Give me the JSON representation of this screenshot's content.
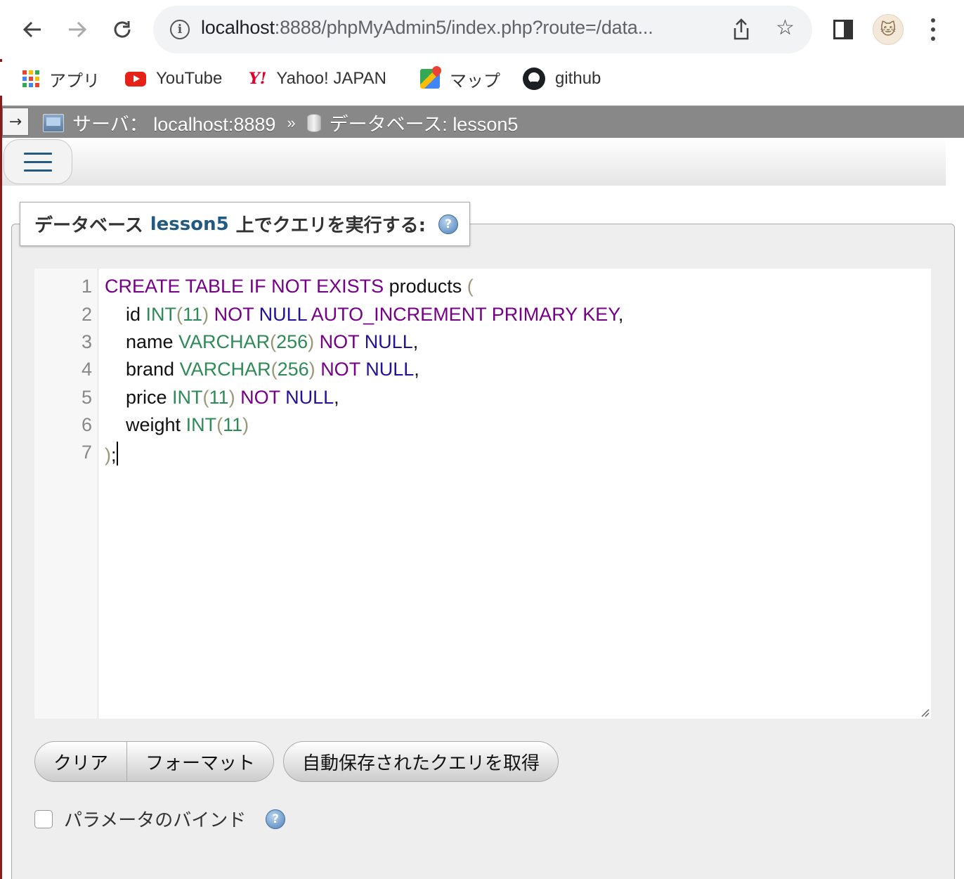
{
  "browser": {
    "url_host": "localhost",
    "url_rest": ":8888/phpMyAdmin5/index.php?route=/data...",
    "bookmarks": [
      {
        "label": "アプリ",
        "icon": "apps-grid-icon"
      },
      {
        "label": "YouTube",
        "icon": "youtube-icon"
      },
      {
        "label": "Yahoo! JAPAN",
        "icon": "yahoo-icon"
      },
      {
        "label": "マップ",
        "icon": "maps-icon"
      },
      {
        "label": "github",
        "icon": "github-icon"
      }
    ]
  },
  "pma": {
    "breadcrumb": {
      "server_label": "サーバ：",
      "server_value": "localhost:8889",
      "separator": "»",
      "database_label": "データベース:",
      "database_value": "lesson5"
    },
    "legend": {
      "prefix": "データベース",
      "database": "lesson5",
      "suffix": "上でクエリを実行する:"
    },
    "editor": {
      "line_numbers": [
        "1",
        "2",
        "3",
        "4",
        "5",
        "6",
        "7"
      ]
    },
    "buttons": {
      "clear": "クリア",
      "format": "フォーマット",
      "autosave": "自動保存されたクエリを取得"
    },
    "bind_params_label": "パラメータのバインド"
  }
}
